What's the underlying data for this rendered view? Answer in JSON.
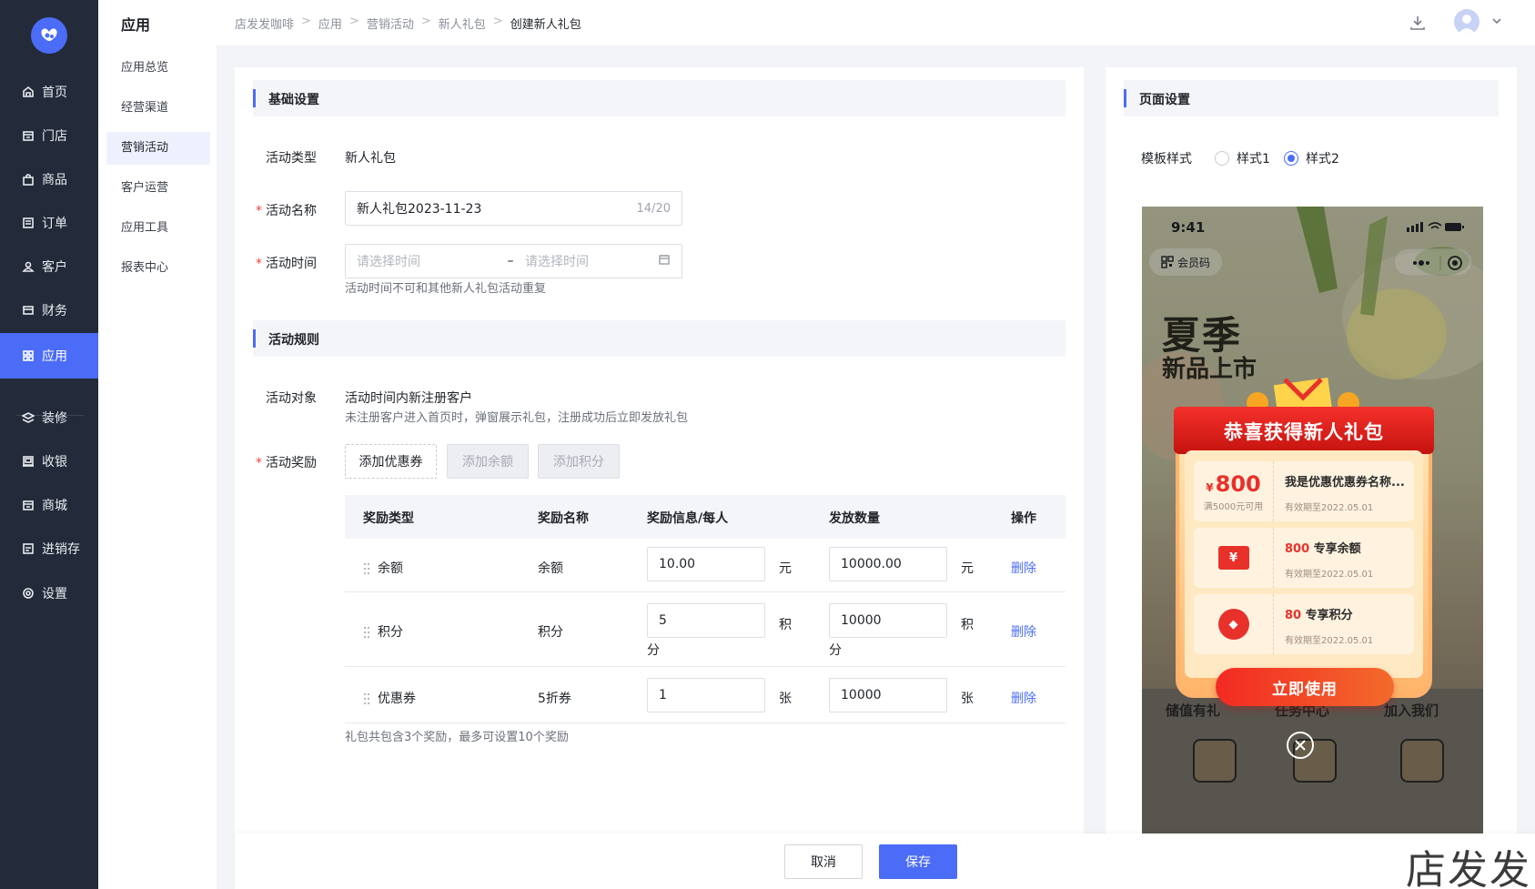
{
  "nav": {
    "items": [
      {
        "label": "首页",
        "icon": "home-icon"
      },
      {
        "label": "门店",
        "icon": "store-icon"
      },
      {
        "label": "商品",
        "icon": "bag-icon"
      },
      {
        "label": "订单",
        "icon": "order-icon"
      },
      {
        "label": "客户",
        "icon": "user-icon"
      },
      {
        "label": "财务",
        "icon": "wallet-icon"
      },
      {
        "label": "应用",
        "icon": "apps-icon",
        "active": true
      },
      {
        "label": "装修",
        "icon": "layers-icon"
      },
      {
        "label": "收银",
        "icon": "cashier-icon"
      },
      {
        "label": "商城",
        "icon": "shop-icon"
      },
      {
        "label": "进销存",
        "icon": "inventory-icon"
      },
      {
        "label": "设置",
        "icon": "settings-icon"
      }
    ]
  },
  "subnav": {
    "title": "应用",
    "items": [
      "应用总览",
      "经营渠道",
      "营销活动",
      "客户运营",
      "应用工具",
      "报表中心"
    ],
    "active_index": 2
  },
  "header": {
    "breadcrumbs": [
      "店发发咖啡",
      "应用",
      "营销活动",
      "新人礼包",
      "创建新人礼包"
    ]
  },
  "basic": {
    "section_title": "基础设置",
    "type_label": "活动类型",
    "type_value": "新人礼包",
    "name_label": "活动名称",
    "name_value": "新人礼包2023-11-23",
    "name_counter": "14/20",
    "time_label": "活动时间",
    "time_start_placeholder": "请选择时间",
    "time_sep": "–",
    "time_end_placeholder": "请选择时间",
    "time_hint": "活动时间不可和其他新人礼包活动重复"
  },
  "rules": {
    "section_title": "活动规则",
    "target_label": "活动对象",
    "target_value": "活动时间内新注册客户",
    "target_hint": "未注册客户进入首页时，弹窗展示礼包，注册成功后立即发放礼包",
    "reward_label": "活动奖励",
    "btn_add_coupon": "添加优惠券",
    "btn_add_balance": "添加余额",
    "btn_add_points": "添加积分",
    "table": {
      "headers": [
        "奖励类型",
        "奖励名称",
        "奖励信息/每人",
        "发放数量",
        "操作"
      ],
      "rows": [
        {
          "type": "余额",
          "name": "余额",
          "info": "10.00",
          "info_unit": "元",
          "qty": "10000.00",
          "qty_unit": "元",
          "action": "删除"
        },
        {
          "type": "积分",
          "name": "积分",
          "info": "5",
          "info_unit": "积",
          "info_unit2": "分",
          "qty": "10000",
          "qty_unit": "积",
          "qty_unit2": "分",
          "action": "删除"
        },
        {
          "type": "优惠券",
          "name": "5折券",
          "info": "1",
          "info_unit": "张",
          "qty": "10000",
          "qty_unit": "张",
          "action": "删除"
        }
      ]
    },
    "summary": "礼包共包含3个奖励，最多可设置10个奖励"
  },
  "side": {
    "section_title": "页面设置",
    "template_label": "模板样式",
    "options": [
      "样式1",
      "样式2"
    ],
    "selected": 1,
    "phone": {
      "time": "9:41",
      "member_code": "会员码",
      "hero_title": "夏季",
      "hero_sub": "新品上市",
      "gift_title": "恭喜获得新人礼包",
      "coupons": [
        {
          "currency": "¥",
          "amount": "800",
          "cond": "满5000元可用",
          "name": "我是优惠优惠券名称...",
          "expire": "有效期至2022.05.01"
        },
        {
          "icon": "¥",
          "highlight": "800",
          "name": " 专享余额",
          "expire": "有效期至2022.05.01"
        },
        {
          "icon": "◆",
          "highlight": "80",
          "name": " 专享积分",
          "expire": "有效期至2022.05.01"
        }
      ],
      "use_button": "立即使用",
      "bottom_labels": [
        "储值有礼",
        "任务中心",
        "加入我们"
      ]
    }
  },
  "footer": {
    "cancel": "取消",
    "save": "保存"
  },
  "watermark": "店发发",
  "colors": {
    "primary": "#4b6cf7",
    "nav_bg": "#232b3a",
    "danger": "#f53f3f"
  }
}
